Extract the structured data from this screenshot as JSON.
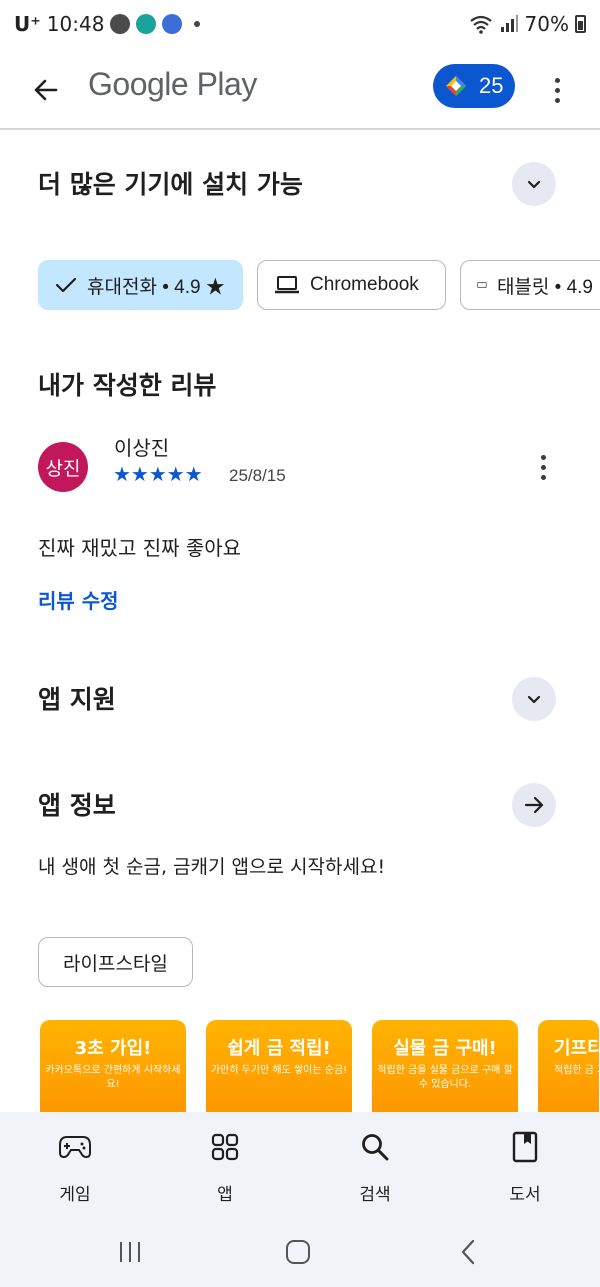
{
  "status_bar": {
    "carrier": "U⁺",
    "time": "10:48",
    "battery": "70%"
  },
  "app_bar": {
    "title": "Google Play",
    "points": "25"
  },
  "devices_section": {
    "title": "더 많은 기기에 설치 가능",
    "chips": [
      {
        "label": "휴대전화 • 4.9 ★",
        "selected": true
      },
      {
        "label": "Chromebook",
        "selected": false
      },
      {
        "label": "태블릿 • 4.9",
        "selected": false
      }
    ]
  },
  "my_review": {
    "title": "내가 작성한 리뷰",
    "avatar_text": "상진",
    "reviewer": "이상진",
    "stars": "★★★★★",
    "rating": 5,
    "date": "25/8/15",
    "body": "진짜 재밌고 진짜 좋아요",
    "edit_link": "리뷰 수정"
  },
  "app_support": {
    "title": "앱 지원"
  },
  "app_info": {
    "title": "앱 정보",
    "description": "내 생애 첫 순금, 금캐기 앱으로 시작하세요!",
    "tag": "라이프스타일"
  },
  "screenshots": [
    {
      "title": "3초 가입!",
      "subtitle": "카카오톡으로 간편하게 시작하세요!"
    },
    {
      "title": "쉽게 금 적립!",
      "subtitle": "가만히 두기만 해도 쌓이는 순금!"
    },
    {
      "title": "실물 금 구매!",
      "subtitle": "적립한 금을 실물 금으로 구매 할 수 있습니다."
    },
    {
      "title": "기프티",
      "subtitle": "적립한 금 기프티콘"
    }
  ],
  "bottom_nav": {
    "items": [
      {
        "label": "게임",
        "icon": "gamepad-icon"
      },
      {
        "label": "앱",
        "icon": "apps-grid-icon"
      },
      {
        "label": "검색",
        "icon": "search-icon"
      },
      {
        "label": "도서",
        "icon": "book-icon"
      }
    ]
  },
  "colors": {
    "accent": "#0b57d0",
    "chip_selected": "#c2e7ff",
    "avatar": "#c2185b",
    "nav_bg": "#f0f4f9"
  }
}
